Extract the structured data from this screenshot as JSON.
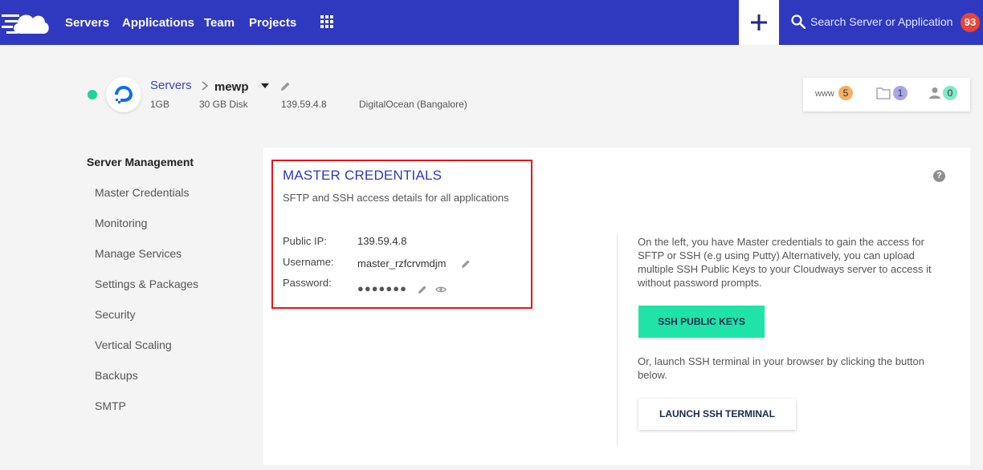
{
  "topnav": {
    "logo_icon": "cloud-logo-icon",
    "links": [
      "Servers",
      "Applications",
      "Team",
      "Projects"
    ],
    "apps_icon": "grid-icon",
    "add_icon": "plus-icon",
    "search_placeholder": "Search Server or Application",
    "notification_count": "93"
  },
  "server": {
    "status": "running",
    "provider_icon": "digitalocean-icon",
    "breadcrumb_root": "Servers",
    "name": "mewp",
    "ram": "1GB",
    "disk": "30 GB Disk",
    "ip": "139.59.4.8",
    "location": "DigitalOcean (Bangalore)"
  },
  "stats": {
    "www_label": "www",
    "www_count": "5",
    "folder_count": "1",
    "users_count": "0"
  },
  "sidebar": {
    "title": "Server Management",
    "items": [
      "Master Credentials",
      "Monitoring",
      "Manage Services",
      "Settings & Packages",
      "Security",
      "Vertical Scaling",
      "Backups",
      "SMTP"
    ]
  },
  "credentials": {
    "title": "MASTER CREDENTIALS",
    "description": "SFTP and SSH access details for all applications",
    "public_ip_label": "Public IP:",
    "public_ip": "139.59.4.8",
    "username_label": "Username:",
    "username": "master_rzfcrvmdjm",
    "password_label": "Password:",
    "password_masked": "●●●●●●●"
  },
  "info": {
    "intro": "On the left, you have Master credentials to gain the access for SFTP or SSH (e.g using Putty) Alternatively, you can upload multiple SSH Public Keys to your Cloudways server to access it without password prompts.",
    "ssh_keys_button": "SSH PUBLIC KEYS",
    "terminal_text": "Or, launch SSH terminal in your browser by clicking the button below.",
    "terminal_button": "LAUNCH SSH TERMINAL"
  },
  "colors": {
    "nav_bg": "#2f39bf",
    "accent_green": "#1fe3a7",
    "highlight_red": "#e4161b",
    "badge_red": "#e8443a",
    "status_green": "#21d39a"
  }
}
